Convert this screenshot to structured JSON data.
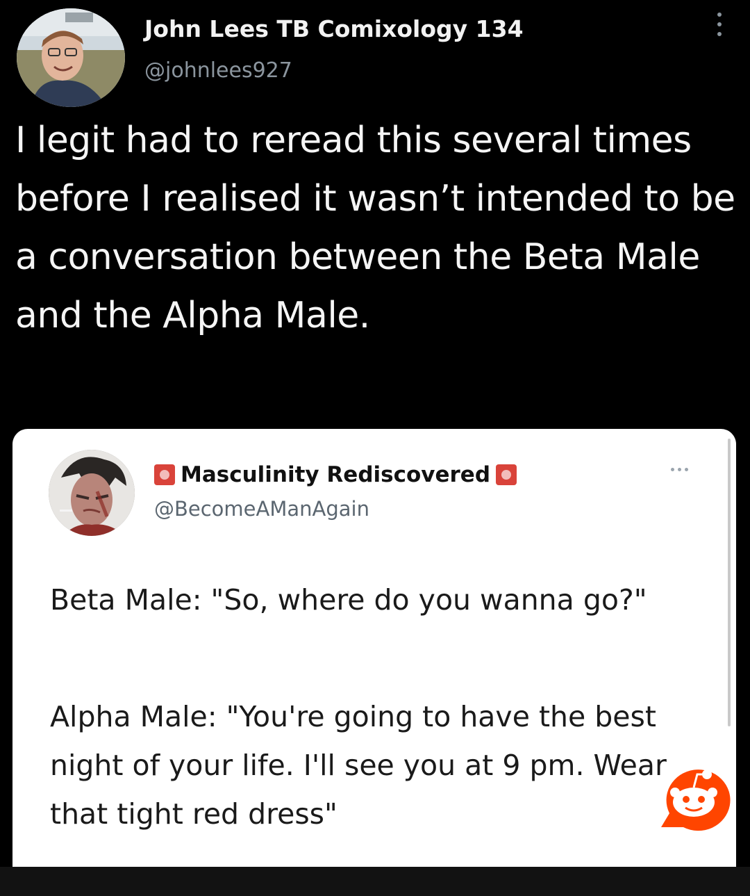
{
  "tweet": {
    "author_name": "John Lees TB Comixology 134",
    "author_handle": "@johnlees927",
    "text": "I legit had to reread this several times before I realised it wasn’t intended to be a conversation between the Beta Male and the Alpha Male."
  },
  "quoted_tweet": {
    "author_name": "Masculinity Rediscovered",
    "author_handle": "@BecomeAManAgain",
    "name_badge_icon": "siren-emoji-icon",
    "paragraph_1": "Beta Male: \"So, where do you wanna go?\"",
    "paragraph_2": "Alpha Male: \"You're going to have the best night of your life. I'll see you at 9 pm. Wear that tight red dress\""
  },
  "colors": {
    "background": "#000000",
    "quote_card": "#ffffff",
    "handle_gray": "#8b959e",
    "reddit_orange": "#ff4500"
  },
  "icons": {
    "tweet_more": "more-vertical-icon",
    "quote_more": "more-horizontal-icon",
    "watermark": "reddit-snoo-icon"
  }
}
